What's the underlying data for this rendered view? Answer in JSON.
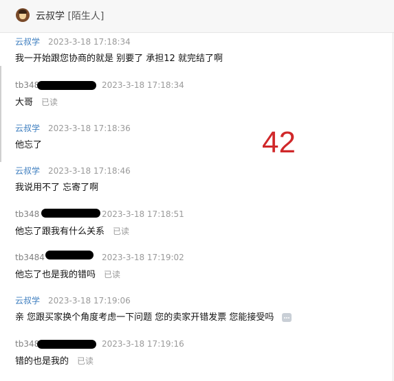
{
  "header": {
    "name": "云叔学",
    "tag": "[陌生人]"
  },
  "overlay_number": "42",
  "messages": [
    {
      "sender": "云叔学",
      "time": "2023-3-18 17:18:34",
      "text": "我一开始跟您协商的就是  别要了 承担12 就完结了啊",
      "status": ""
    },
    {
      "sender": "tb348",
      "time": "2023-3-18 17:18:34",
      "text": "大哥",
      "status": "已读"
    },
    {
      "sender": "云叔学",
      "time": "2023-3-18 17:18:36",
      "text": "他忘了",
      "status": ""
    },
    {
      "sender": "云叔学",
      "time": "2023-3-18 17:18:46",
      "text": "我说用不了 忘寄了啊",
      "status": ""
    },
    {
      "sender": "tb348",
      "time": "2023-3-18 17:18:51",
      "text": "他忘了跟我有什么关系",
      "status": "已读"
    },
    {
      "sender": "tb3484",
      "time": "2023-3-18 17:19:02",
      "text": "他忘了也是我的错吗",
      "status": "已读"
    },
    {
      "sender": "云叔学",
      "time": "2023-3-18 17:19:06",
      "text": "亲 您跟买家换个角度考虑一下问题  您的卖家开错发票  您能接受吗",
      "status": ""
    },
    {
      "sender": "tb348",
      "time": "2023-3-18 17:19:16",
      "text": "错的也是我的",
      "status": "已读"
    }
  ]
}
